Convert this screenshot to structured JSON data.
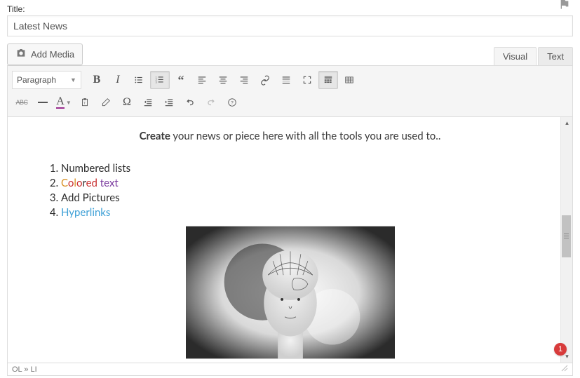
{
  "title": {
    "label": "Title:",
    "value": "Latest News"
  },
  "media_button": {
    "label": "Add Media"
  },
  "tabs": {
    "visual": "Visual",
    "text": "Text"
  },
  "format_select": {
    "label": "Paragraph"
  },
  "content": {
    "headline_bold": "Create",
    "headline_rest": " your news or piece here with all the tools you are used to..",
    "list": [
      {
        "type": "plain",
        "text": "Numbered lists"
      },
      {
        "type": "colored",
        "parts": [
          "C",
          "o",
          "l",
          "o",
          "r",
          "e",
          "d",
          " text"
        ]
      },
      {
        "type": "plain",
        "text": "Add Pictures"
      },
      {
        "type": "link",
        "text": "Hyperlinks"
      }
    ]
  },
  "status": {
    "path": "OL » LI"
  },
  "notification": {
    "count": "1"
  }
}
